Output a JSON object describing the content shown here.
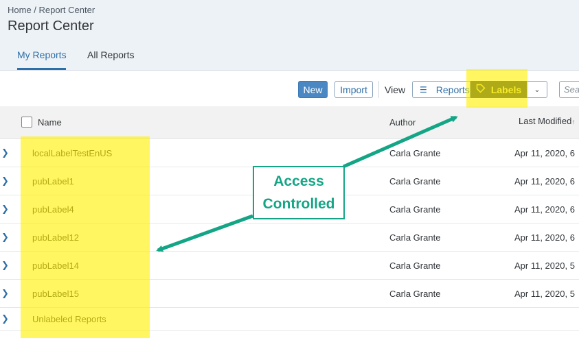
{
  "header": {
    "breadcrumb": "Home / Report Center",
    "title": "Report Center",
    "tabs": [
      {
        "label": "My Reports",
        "active": true
      },
      {
        "label": "All Reports",
        "active": false
      }
    ]
  },
  "toolbar": {
    "new_label": "New",
    "import_label": "Import",
    "view_label": "View",
    "reports_label": "Reports",
    "labels_label": "Labels",
    "search_placeholder": "Sea"
  },
  "table": {
    "columns": [
      "Name",
      "Author",
      "Last Modified"
    ],
    "rows": [
      {
        "name": "localLabelTestEnUS",
        "author": "Carla Grante",
        "modified": "Apr 11, 2020, 6"
      },
      {
        "name": "pubLabel1",
        "author": "Carla Grante",
        "modified": "Apr 11, 2020, 6"
      },
      {
        "name": "pubLabel4",
        "author": "Carla Grante",
        "modified": "Apr 11, 2020, 6"
      },
      {
        "name": "pubLabel12",
        "author": "Carla Grante",
        "modified": "Apr 11, 2020, 6"
      },
      {
        "name": "pubLabel14",
        "author": "Carla Grante",
        "modified": "Apr 11, 2020, 5"
      },
      {
        "name": "pubLabel15",
        "author": "Carla Grante",
        "modified": "Apr 11, 2020, 5"
      },
      {
        "name": "Unlabeled Reports",
        "author": "",
        "modified": ""
      }
    ]
  },
  "annotation": {
    "line1": "Access",
    "line2": "Controlled",
    "color": "#13a585",
    "highlight_color": "#fff000"
  },
  "icons": {
    "reports": "list-icon",
    "labels": "tag-icon",
    "menu": "chevron-down-icon",
    "row": "chevron-right-icon"
  }
}
